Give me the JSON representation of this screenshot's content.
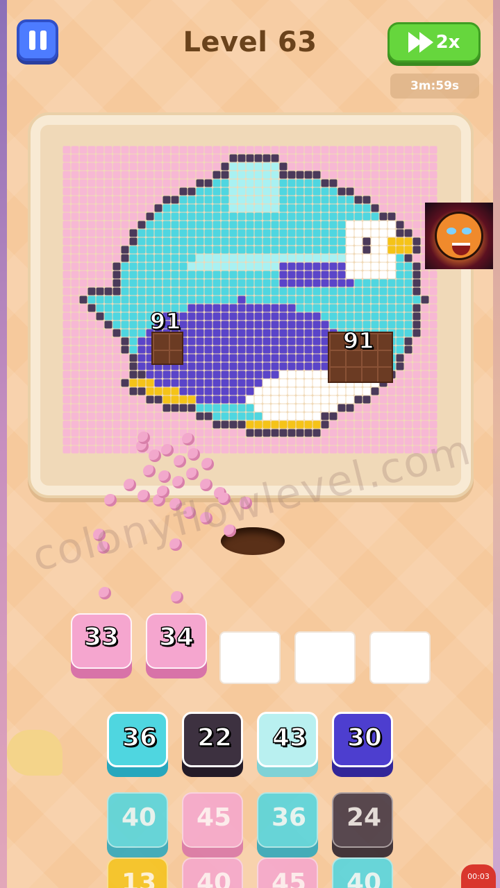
{
  "header": {
    "level_title": "Level 63",
    "speed_label": "2x",
    "timer": "3m:59s"
  },
  "board": {
    "chocolates": [
      {
        "count": "91"
      },
      {
        "count": "91"
      }
    ],
    "colors": {
      "background": "#f7b8d4",
      "outline": "#4a3a5a",
      "cyan": "#4fd6e0",
      "light_cyan": "#a9f1f2",
      "indigo": "#5a44c9",
      "white": "#ffffff",
      "yellow": "#f5c318",
      "chocolate": "#6b3b23"
    }
  },
  "queue": {
    "slots": [
      {
        "value": "33",
        "color": "#f5a6cf"
      },
      {
        "value": "34",
        "color": "#f5a6cf"
      },
      {
        "value": ""
      },
      {
        "value": ""
      },
      {
        "value": ""
      }
    ]
  },
  "tiles": {
    "rows": [
      [
        {
          "value": "36",
          "color": "#4fd6e0",
          "side": "#27a7bd"
        },
        {
          "value": "22",
          "color": "#3d3140",
          "side": "#241b27"
        },
        {
          "value": "43",
          "color": "#b9f0f0",
          "side": "#7fd2d6"
        },
        {
          "value": "30",
          "color": "#4d3ecf",
          "side": "#322699"
        }
      ],
      [
        {
          "value": "40",
          "color": "#4fd6e0",
          "side": "#27a7bd"
        },
        {
          "value": "45",
          "color": "#f5a6cf",
          "side": "#d873a8"
        },
        {
          "value": "36",
          "color": "#4fd6e0",
          "side": "#27a7bd"
        },
        {
          "value": "24",
          "color": "#3d3140",
          "side": "#241b27"
        }
      ],
      [
        {
          "value": "13",
          "color": "#f5c318",
          "side": "#d19a10"
        },
        {
          "value": "40",
          "color": "#f5a6cf",
          "side": "#d873a8"
        },
        {
          "value": "45",
          "color": "#f5a6cf",
          "side": "#d873a8"
        },
        {
          "value": "40",
          "color": "#4fd6e0",
          "side": "#27a7bd"
        }
      ]
    ]
  },
  "watermark": "colonyflowlevel.com",
  "recording_timer": "00:03",
  "icons": [
    "pause-icon",
    "fast-forward-icon",
    "tiger-avatar-icon"
  ]
}
